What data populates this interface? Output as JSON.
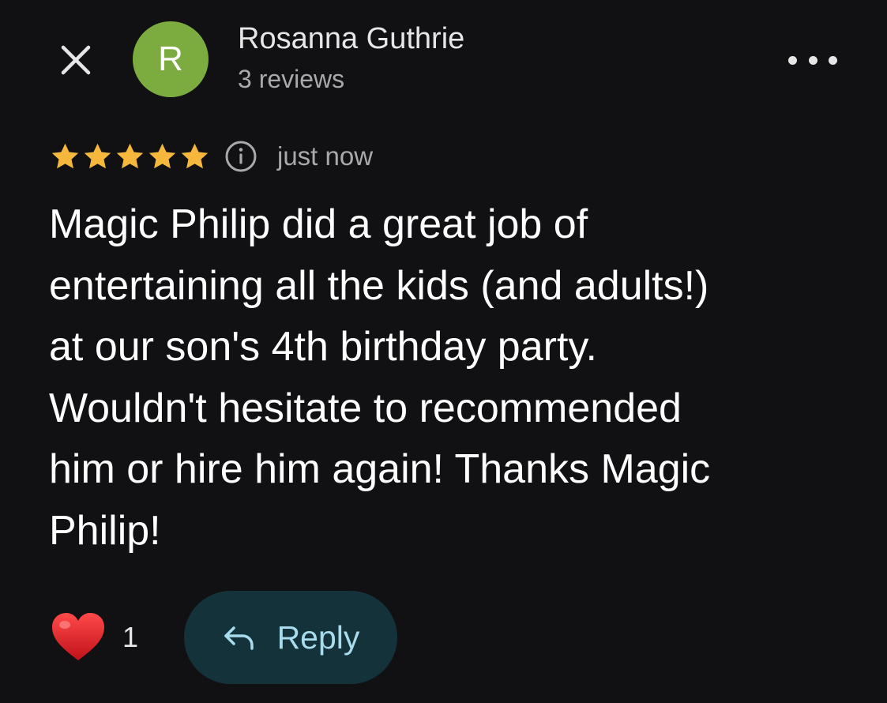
{
  "header": {
    "avatar_letter": "R",
    "avatar_color": "#7cac3f",
    "author_name": "Rosanna Guthrie",
    "review_count": "3 reviews",
    "close_icon": "close-icon",
    "more_icon": "more-horizontal-icon"
  },
  "rating": {
    "stars": 5,
    "max_stars": 5,
    "star_color": "#f5b83d",
    "info_icon": "info-icon",
    "timestamp": "just now"
  },
  "review": {
    "text": "Magic Philip did a great job of\nentertaining all the kids (and adults!)\nat our son's 4th birthday party.\nWouldn't hesitate to recommended\nhim or hire him again! Thanks Magic\nPhilip!"
  },
  "actions": {
    "like_icon": "heart-icon",
    "like_count": "1",
    "reply_icon": "reply-arrow-icon",
    "reply_label": "Reply",
    "reply_bg": "#14323a",
    "reply_text_color": "#a8dcec"
  }
}
